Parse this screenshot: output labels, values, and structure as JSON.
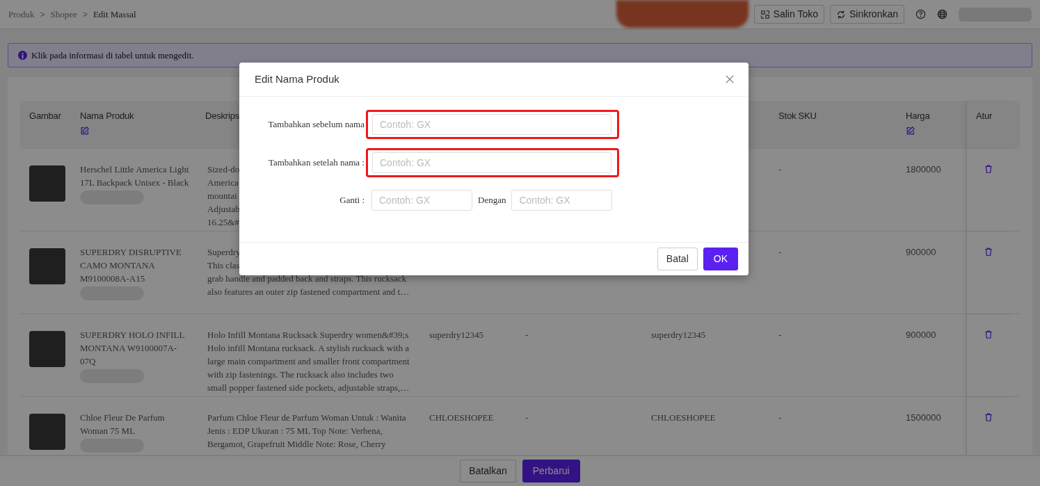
{
  "breadcrumb": [
    {
      "label": "Produk",
      "current": false
    },
    {
      "label": "Shopee",
      "current": false
    },
    {
      "label": "Edit Massal",
      "current": true
    }
  ],
  "breadcrumb_separator": ">",
  "toolbar": {
    "copy_button": "Salin Toko",
    "sync_button": "Sinkronkan"
  },
  "alert": "Klik pada informasi di tabel untuk mengedit.",
  "table": {
    "columns": [
      {
        "label": "Gambar",
        "editable": false
      },
      {
        "label": "Nama Produk",
        "editable": true
      },
      {
        "label": "Deskrips",
        "editable": false
      },
      {
        "label": "Stok SKU",
        "editable": false
      },
      {
        "label": "Harga",
        "editable": true
      },
      {
        "label": "Atur",
        "editable": false
      }
    ],
    "rows": [
      {
        "name": "Herschel Little America Light 17L Backpack Unisex - Black",
        "description_lines": [
          "Sized-do",
          "America",
          "mountai",
          "Adjustab",
          "16.25&#"
        ],
        "stok_sku": "-",
        "harga": "1800000"
      },
      {
        "name": "SUPERDRY DISRUPTIVE CAMO MONTANA M9100008A-A15",
        "description_lines": [
          "Superdry",
          "This clas",
          "grab handle and padded back and straps. This rucksack",
          "also features an outer zip fastened compartment and t…"
        ],
        "stok_sku": "-",
        "harga": "900000"
      },
      {
        "name": "SUPERDRY HOLO INFILL MONTANA W9100007A-07Q",
        "description_lines": [
          "Holo Infill Montana Rucksack Superdry women&#39;s Holo infill Montana rucksack. A stylish rucksack with a large main compartment and smaller front compartment with zip fastenings. The rucksack also includes two small popper fastened side pockets, adjustable straps,…"
        ],
        "column_4": "superdry12345",
        "column_5": "-",
        "column_6": "superdry12345",
        "stok_sku": "-",
        "harga": "900000"
      },
      {
        "name": "Chloe Fleur De Parfum Woman 75 ML",
        "description_lines": [
          "Parfum Chloe Fleur de Parfum Woman Untuk : Wanita Jenis : EDP Ukuran : 75 ML Top Note: Verbena, Bergamot, Grapefruit Middle Note: Rose, Cherry"
        ],
        "column_4": "CHLOESHOPEE",
        "column_5": "-",
        "column_6": "CHLOESHOPEE",
        "stok_sku": "-",
        "harga": "1500000"
      }
    ]
  },
  "footer": {
    "cancel_button": "Batalkan",
    "update_button": "Perbarui"
  },
  "modal": {
    "title": "Edit Nama Produk",
    "fields": [
      {
        "label": "Tambahkan sebelum nama",
        "placeholder": "Contoh: GX",
        "highlighted": true
      },
      {
        "label": "Tambahkan setelah nama :",
        "placeholder": "Contoh: GX",
        "highlighted": true
      }
    ],
    "replace": {
      "label": "Ganti :",
      "placeholder": "Contoh: GX",
      "with_label": "Dengan",
      "with_placeholder": "Contoh: GX"
    },
    "cancel_button": "Batal",
    "ok_button": "OK"
  }
}
